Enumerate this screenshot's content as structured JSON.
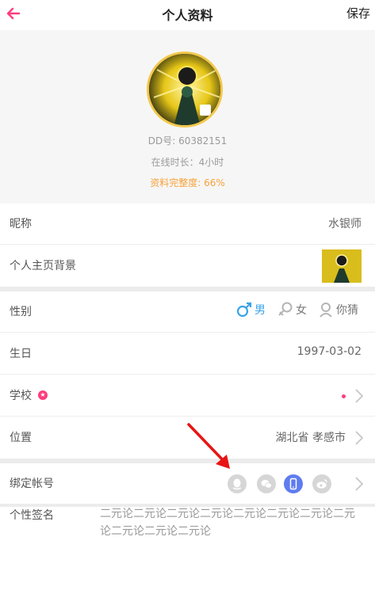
{
  "header": {
    "title": "个人资料",
    "save_label": "保存"
  },
  "profile": {
    "dd_number": "DD号: 60382151",
    "online_time": "在线时长：4小时",
    "completeness": "资料完整度: 66%"
  },
  "rows": {
    "nickname": {
      "label": "昵称",
      "value": "水银师"
    },
    "background": {
      "label": "个人主页背景"
    },
    "gender": {
      "label": "性别",
      "options": [
        "男",
        "女",
        "你猜"
      ],
      "selected": "男"
    },
    "birthday": {
      "label": "生日",
      "value": "1997-03-02"
    },
    "school": {
      "label": "学校"
    },
    "location": {
      "label": "位置",
      "value": "湖北省 孝感市"
    },
    "bind": {
      "label": "绑定帐号",
      "accounts": [
        "qq-icon",
        "wechat-icon",
        "phone-icon",
        "weibo-icon"
      ],
      "bound": "phone"
    }
  },
  "signature": {
    "label": "个性签名",
    "text": "二元论二元论二元论二元论二元论二元论二元论二元论二元论二元论二元论"
  },
  "colors": {
    "accent": "#3aa3e8",
    "pink": "#ff3c7e",
    "orange": "#f7a23b",
    "phone_bound": "#5f7cf0"
  }
}
